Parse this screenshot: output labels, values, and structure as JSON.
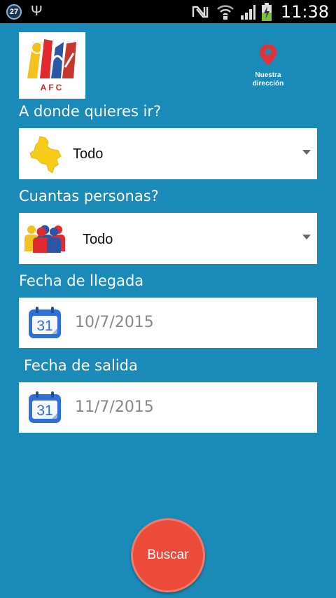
{
  "status_bar": {
    "badge": "27",
    "usb_glyph": "Ψ",
    "time": "11:38",
    "icons": [
      "usb-icon",
      "nfc-icon",
      "wifi-icon",
      "signal-icon",
      "battery-charging-icon"
    ]
  },
  "header": {
    "logo_text": "AFC",
    "address_label_line1": "Nuestra",
    "address_label_line2": "dirección"
  },
  "form": {
    "destination": {
      "label": "A donde quieres ir?",
      "value": "Todo",
      "icon": "colombia-map-icon"
    },
    "guests": {
      "label": "Cuantas personas?",
      "value": "Todo",
      "icon": "people-icon"
    },
    "arrival": {
      "label": "Fecha de llegada",
      "value": "10/7/2015",
      "calendar_day": "31",
      "icon": "calendar-icon"
    },
    "departure": {
      "label": "Fecha de salida",
      "value": "11/7/2015",
      "calendar_day": "31",
      "icon": "calendar-icon"
    }
  },
  "actions": {
    "search_label": "Buscar"
  },
  "colors": {
    "background": "#1a8ab8",
    "button": "#ec4b3a",
    "pin": "#e0323a"
  }
}
